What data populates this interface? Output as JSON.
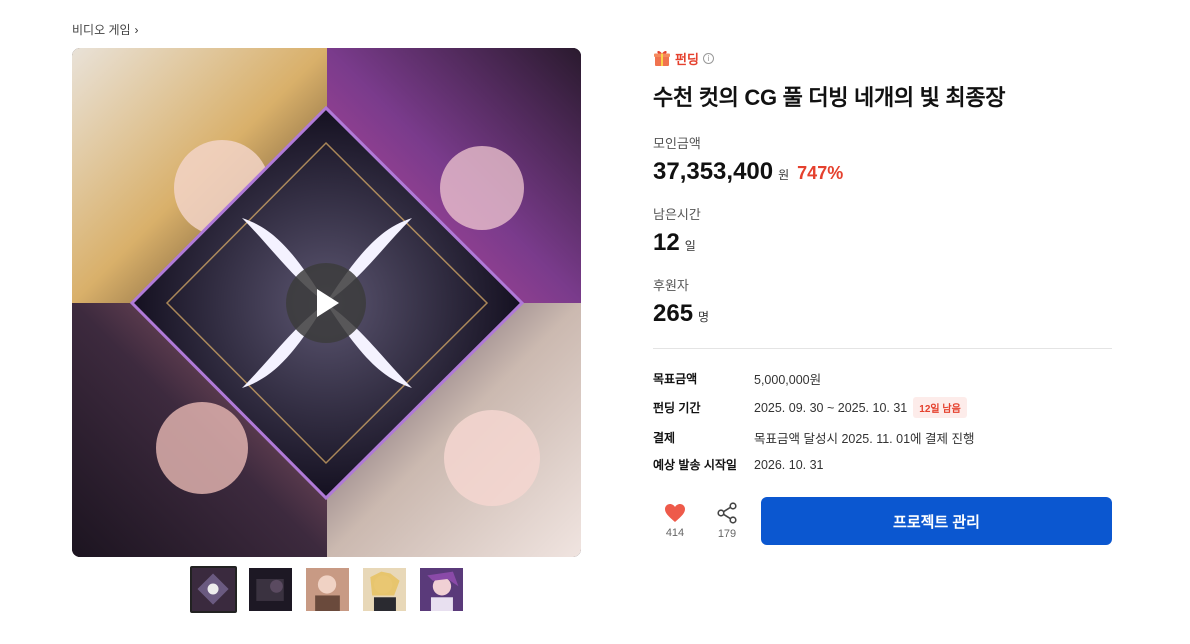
{
  "breadcrumb": {
    "label": "비디오 게임"
  },
  "badge": {
    "label": "펀딩"
  },
  "project": {
    "title": "수천 컷의 CG 풀 더빙 네개의 빛 최종장"
  },
  "stats": {
    "raised": {
      "label": "모인금액",
      "value": "37,353,400",
      "unit": "원",
      "percent": "747%"
    },
    "remaining": {
      "label": "남은시간",
      "value": "12",
      "unit": "일"
    },
    "backers": {
      "label": "후원자",
      "value": "265",
      "unit": "명"
    }
  },
  "details": [
    {
      "key": "목표금액",
      "value": "5,000,000원"
    },
    {
      "key": "펀딩 기간",
      "value": "2025. 09. 30 ~ 2025. 10. 31",
      "pill": "12일 남음"
    },
    {
      "key": "결제",
      "value": "목표금액 달성시 2025. 11. 01에 결제 진행"
    },
    {
      "key": "예상 발송 시작일",
      "value": "2026. 10. 31"
    }
  ],
  "actions": {
    "like_count": "414",
    "share_count": "179",
    "primary_label": "프로젝트 관리"
  },
  "colors": {
    "accent": "#e5412e",
    "primary": "#0b57d0"
  }
}
